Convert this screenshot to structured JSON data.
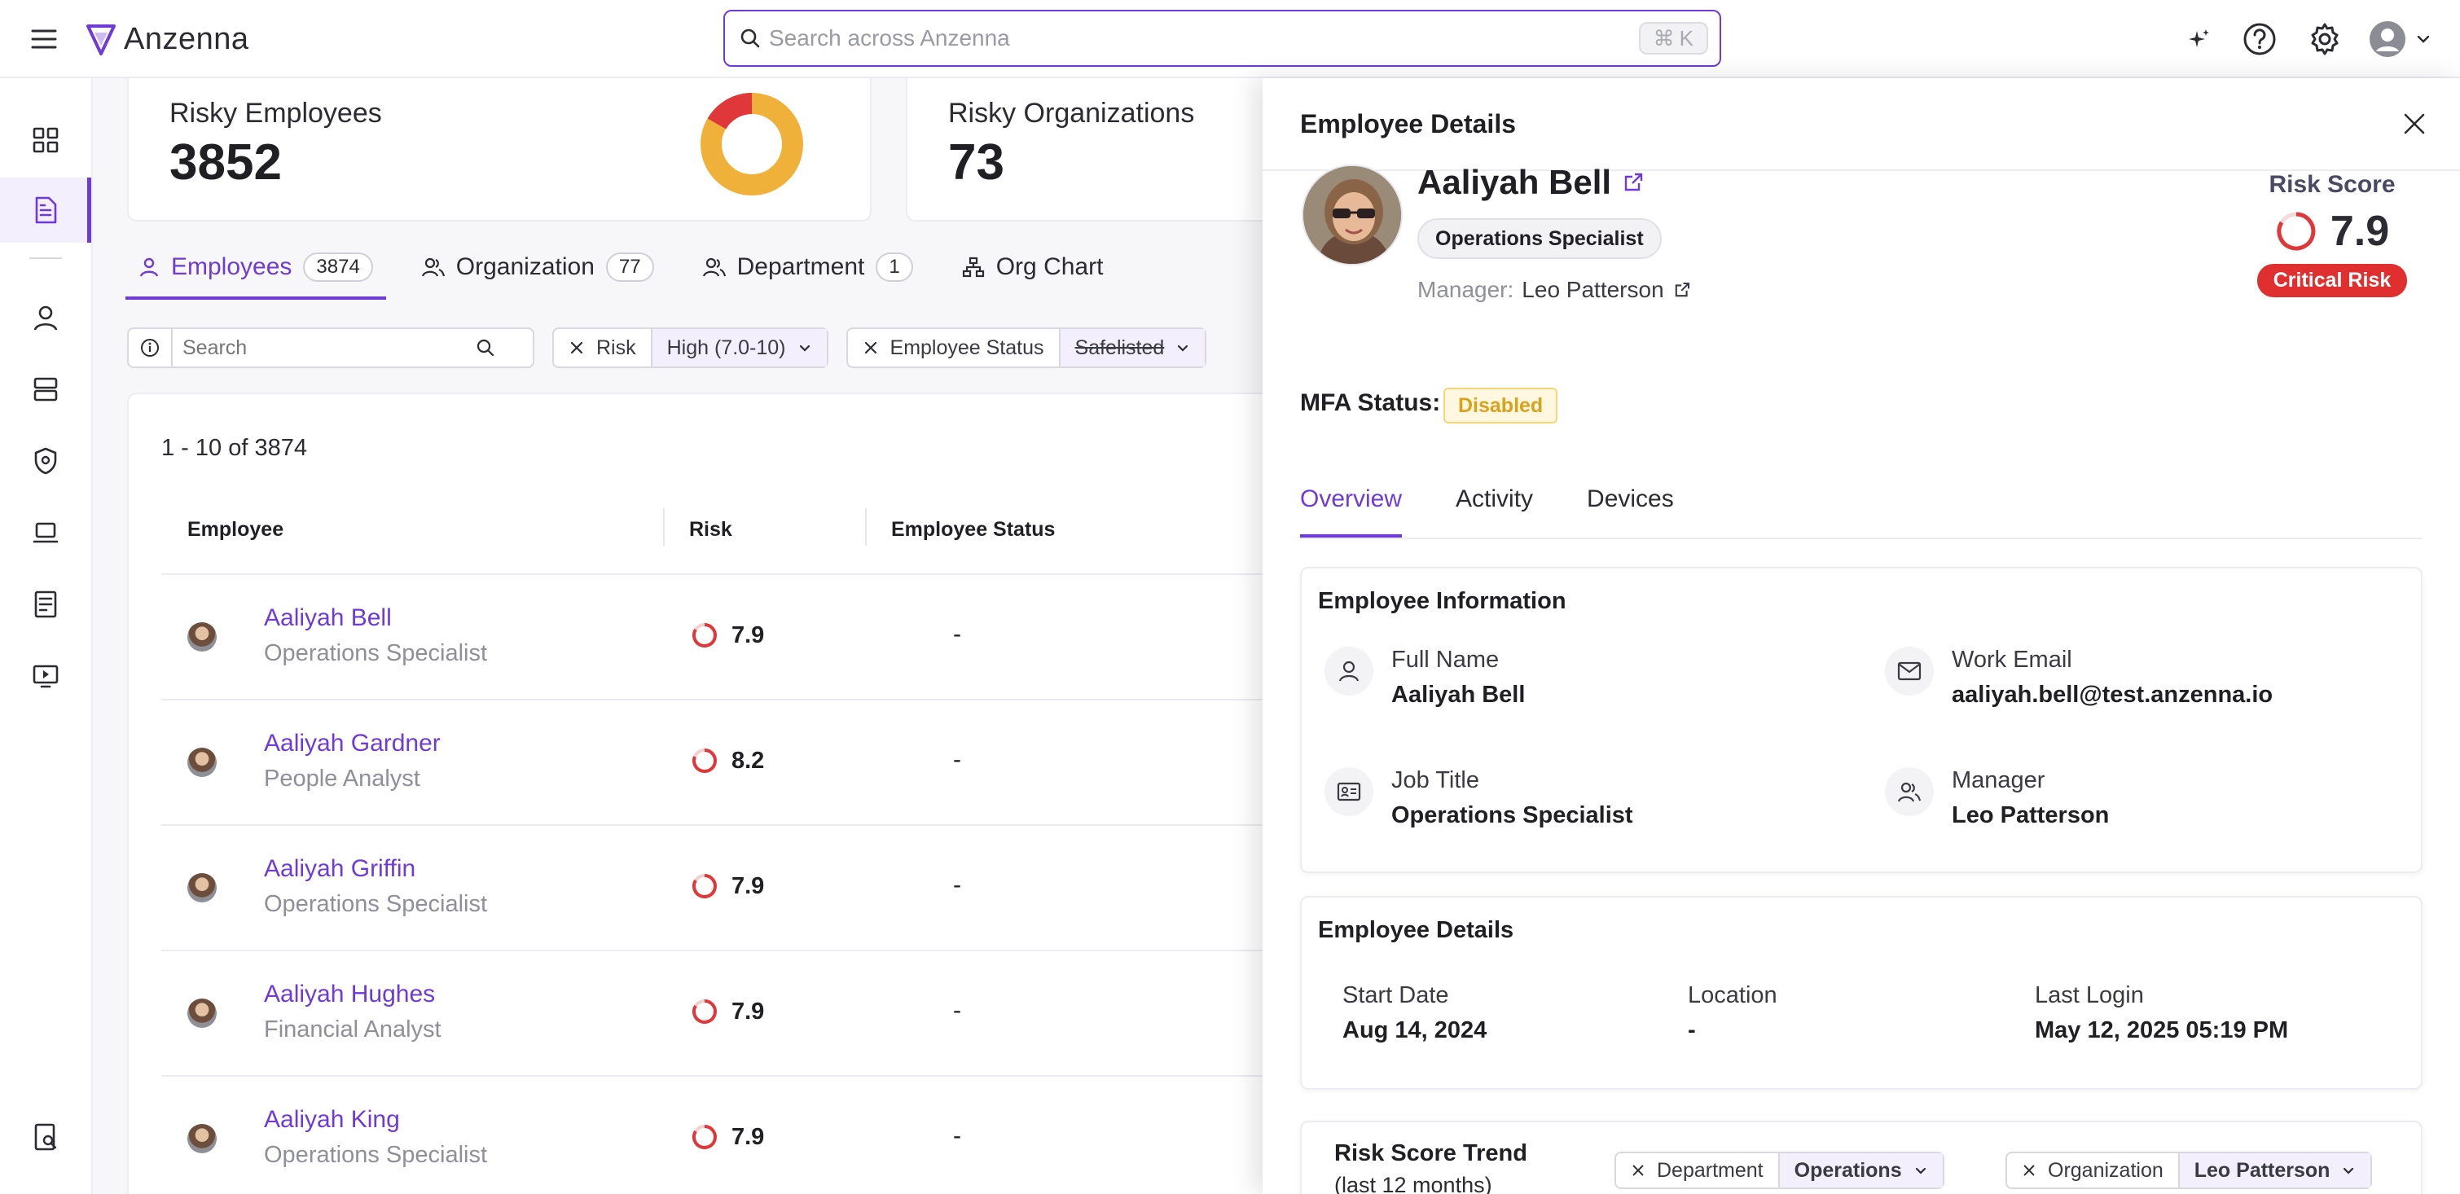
{
  "app": {
    "name": "Anzenna"
  },
  "search": {
    "placeholder": "Search across Anzenna",
    "shortcut": "K",
    "shortcut_icon": "command-icon"
  },
  "top_icons": [
    "sparkles-icon",
    "help-icon",
    "gear-icon",
    "user-avatar-icon",
    "chevron-down-icon"
  ],
  "stats": {
    "risky_employees": {
      "label": "Risky Employees",
      "value": "3852"
    },
    "risky_organizations": {
      "label": "Risky Organizations",
      "value": "73"
    }
  },
  "tabs": [
    {
      "label": "Employees",
      "count": "3874"
    },
    {
      "label": "Organization",
      "count": "77"
    },
    {
      "label": "Department",
      "count": "1"
    },
    {
      "label": "Org Chart"
    }
  ],
  "filters": {
    "search_placeholder": "Search",
    "risk": {
      "label": "Risk",
      "value": "High (7.0-10)"
    },
    "status": {
      "label": "Employee Status",
      "value": "Safelisted"
    }
  },
  "table": {
    "range": "1 - 10 of 3874",
    "columns": [
      "Employee",
      "Risk",
      "Employee Status"
    ],
    "rows": [
      {
        "name": "Aaliyah Bell",
        "title": "Operations Specialist",
        "risk": "7.9",
        "status": "-"
      },
      {
        "name": "Aaliyah Gardner",
        "title": "People Analyst",
        "risk": "8.2",
        "status": "-"
      },
      {
        "name": "Aaliyah Griffin",
        "title": "Operations Specialist",
        "risk": "7.9",
        "status": "-"
      },
      {
        "name": "Aaliyah Hughes",
        "title": "Financial Analyst",
        "risk": "7.9",
        "status": "-"
      },
      {
        "name": "Aaliyah King",
        "title": "Operations Specialist",
        "risk": "7.9",
        "status": "-"
      }
    ]
  },
  "details": {
    "header": "Employee Details",
    "name": "Aaliyah Bell",
    "title": "Operations Specialist",
    "manager_label": "Manager:",
    "manager": "Leo Patterson",
    "risk_label": "Risk Score",
    "risk_score": "7.9",
    "risk_level": "Critical Risk",
    "mfa_label": "MFA Status:",
    "mfa_value": "Disabled",
    "tabs": [
      "Overview",
      "Activity",
      "Devices"
    ],
    "info_title": "Employee Information",
    "info": {
      "full_name": {
        "label": "Full Name",
        "value": "Aaliyah Bell"
      },
      "work_email": {
        "label": "Work Email",
        "value": "aaliyah.bell@test.anzenna.io"
      },
      "job_title": {
        "label": "Job Title",
        "value": "Operations Specialist"
      },
      "manager": {
        "label": "Manager",
        "value": "Leo Patterson"
      }
    },
    "details_title": "Employee Details",
    "start_date": {
      "label": "Start Date",
      "value": "Aug 14, 2024"
    },
    "location": {
      "label": "Location",
      "value": "-"
    },
    "last_login": {
      "label": "Last Login",
      "value": "May 12, 2025 05:19 PM"
    },
    "trend_title": "Risk Score Trend",
    "trend_sub": "(last 12 months)",
    "trend_filters": {
      "department": {
        "label": "Department",
        "value": "Operations"
      },
      "organization": {
        "label": "Organization",
        "value": "Leo Patterson"
      }
    }
  },
  "colors": {
    "accent": "#6f3bd6",
    "critical": "#e02f2f",
    "donut_main": "#f0b13b",
    "donut_alt": "#e0373a",
    "warning_bg": "#fff7df"
  }
}
